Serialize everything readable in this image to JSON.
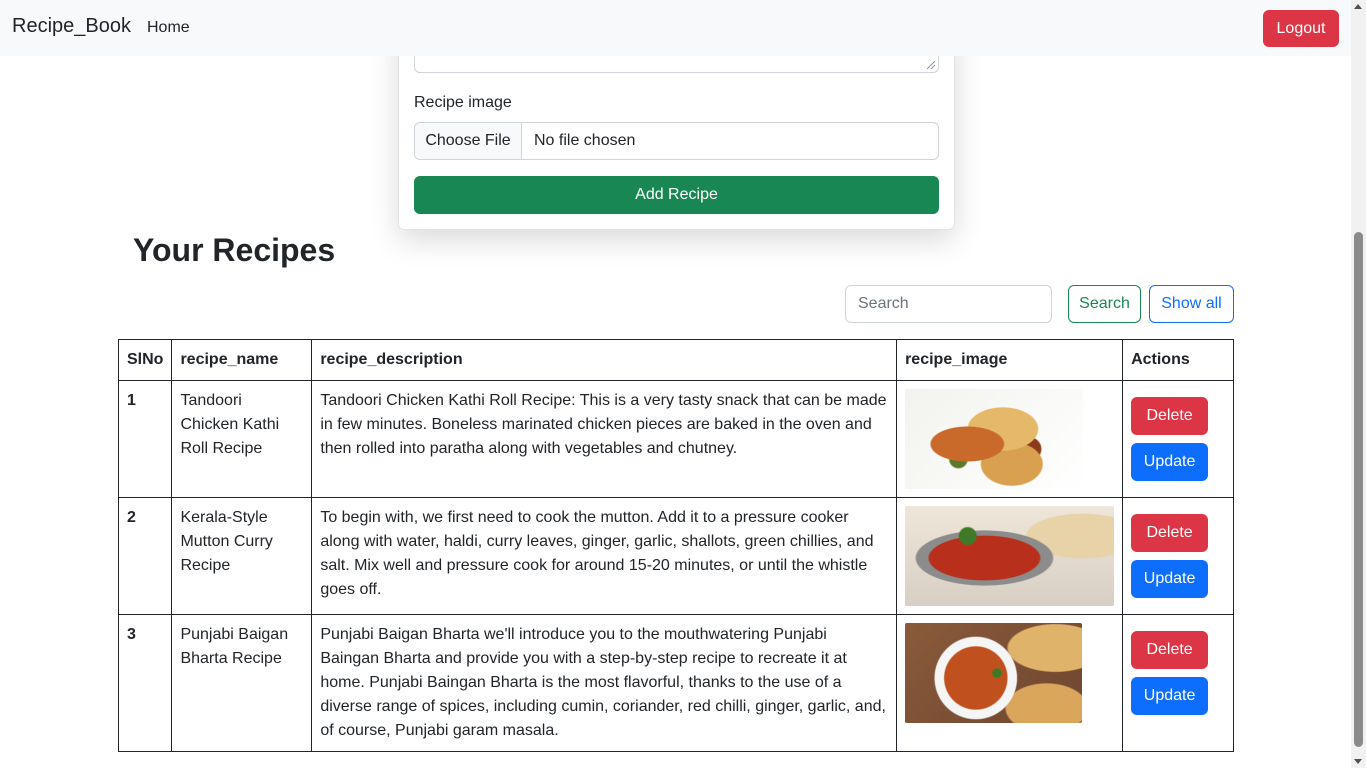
{
  "navbar": {
    "brand": "Recipe_Book",
    "home": "Home",
    "logout": "Logout"
  },
  "form": {
    "image_label": "Recipe image",
    "choose_file": "Choose File",
    "no_file": "No file chosen",
    "submit": "Add Recipe"
  },
  "section_title": "Your Recipes",
  "search": {
    "placeholder": "Search",
    "button": "Search",
    "show_all": "Show all"
  },
  "table": {
    "headers": [
      "SlNo",
      "recipe_name",
      "recipe_description",
      "recipe_image",
      "Actions"
    ],
    "rows": [
      {
        "slno": "1",
        "name": "Tandoori Chicken Kathi Roll Recipe",
        "description": "Tandoori Chicken Kathi Roll Recipe: This is a very tasty snack that can be made in few minutes. Boneless marinated chicken pieces are baked in the oven and then rolled into paratha along with vegetables and chutney.",
        "delete": "Delete",
        "update": "Update"
      },
      {
        "slno": "2",
        "name": "Kerala-Style Mutton Curry Recipe",
        "description": "To begin with, we first need to cook the mutton. Add it to a pressure cooker along with water, haldi, curry leaves, ginger, garlic, shallots, green chillies, and salt. Mix well and pressure cook for around 15-20 minutes, or until the whistle goes off.",
        "delete": "Delete",
        "update": "Update"
      },
      {
        "slno": "3",
        "name": "Punjabi Baigan Bharta Recipe",
        "description": "Punjabi Baigan Bharta we'll introduce you to the mouthwatering Punjabi Baingan Bharta and provide you with a step-by-step recipe to recreate it at home. Punjabi Baingan Bharta is the most flavorful, thanks to the use of a diverse range of spices, including cumin, coriander, red chilli, ginger, garlic, and, of course, Punjabi garam masala.",
        "delete": "Delete",
        "update": "Update"
      }
    ]
  },
  "colors": {
    "danger": "#dc3545",
    "success": "#198754",
    "primary": "#0d6efd",
    "navbar_bg": "#f8f9fa"
  }
}
